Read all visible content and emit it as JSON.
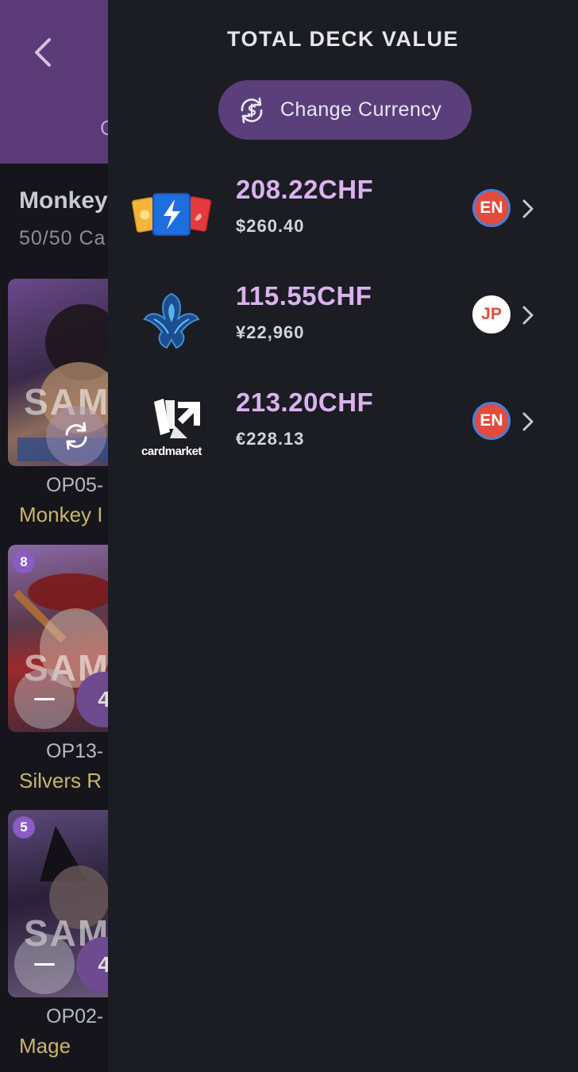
{
  "background_screen": {
    "tab_peek": "C",
    "deck_title": "Monkey",
    "deck_count": "50/50 Ca",
    "cards": [
      {
        "cost": "",
        "code": "OP05-",
        "name": "Monkey I",
        "sample": "SAM",
        "action": "swap"
      },
      {
        "cost": "8",
        "code": "OP13-",
        "name": "Silvers R",
        "sample": "SAM",
        "qty": "4"
      },
      {
        "cost": "5",
        "code": "OP02-",
        "name": "Mage",
        "sample": "SAM",
        "qty": "4"
      }
    ]
  },
  "drawer": {
    "title": "TOTAL DECK VALUE",
    "change_currency_label": "Change Currency",
    "rows": [
      {
        "logo": "tcgplayer-cards-icon",
        "price": "208.22CHF",
        "original": "$260.40",
        "lang": "EN"
      },
      {
        "logo": "phoenix-icon",
        "price": "115.55CHF",
        "original": "¥22,960",
        "lang": "JP"
      },
      {
        "logo": "cardmarket-logo",
        "logo_text": "cardmarket",
        "price": "213.20CHF",
        "original": "€228.13",
        "lang": "EN"
      }
    ]
  },
  "colors": {
    "header_purple": "#5b3a78",
    "drawer_bg": "#1c1c23",
    "button_purple": "#5a3f7a",
    "price_lilac": "#d9b2ef",
    "card_name_gold": "#c9b56a",
    "en_badge": "#e24b3d",
    "en_badge_ring": "#4a7fd4"
  }
}
